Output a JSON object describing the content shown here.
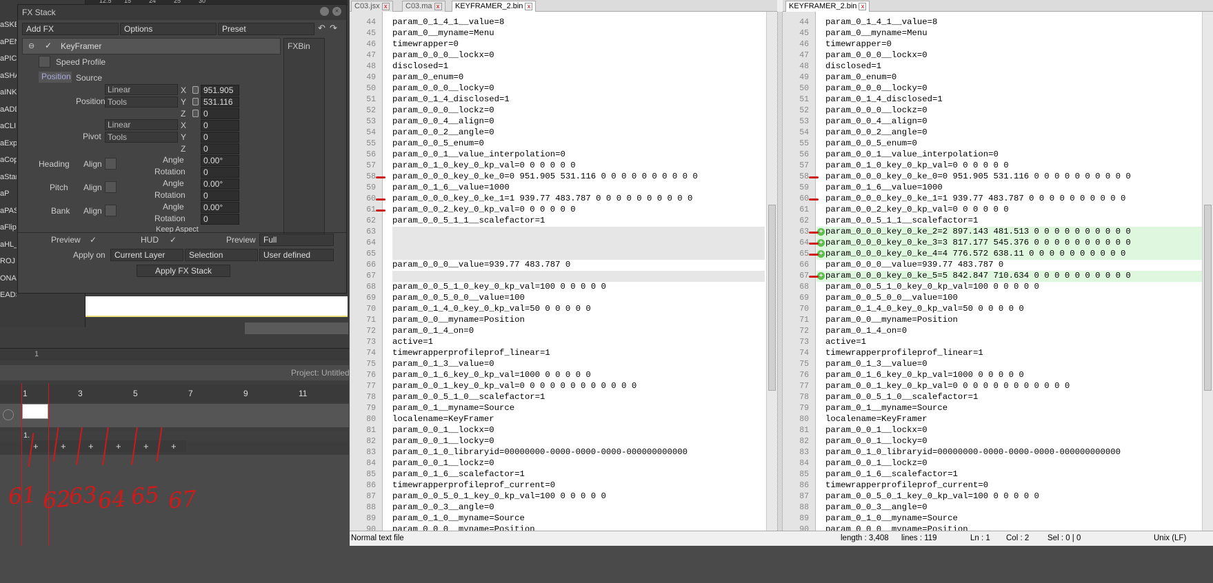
{
  "fx": {
    "title": "FX Stack",
    "add_fx": "Add FX",
    "options": "Options",
    "preset": "Preset",
    "effect_name": "KeyFramer",
    "speed_profile": "Speed Profile",
    "fxbin": "FXBin",
    "tab_position": "Position",
    "tab_source": "Source",
    "position_label": "Position",
    "pivot_label": "Pivot",
    "heading_label": "Heading",
    "pitch_label": "Pitch",
    "bank_label": "Bank",
    "align": "Align",
    "angle": "Angle",
    "rotation": "Rotation",
    "keep_aspect": "Keep Aspect",
    "linear": "Linear",
    "tools": "Tools",
    "x": "X",
    "y": "Y",
    "z": "Z",
    "pos_x": "951.905",
    "pos_y": "531.116",
    "pos_z": "0",
    "piv_x": "0",
    "piv_y": "0",
    "piv_z": "0",
    "heading_angle": "0.00°",
    "heading_rot": "0",
    "pitch_angle": "0.00°",
    "pitch_rot": "0",
    "bank_angle": "0.00°",
    "bank_rot": "0",
    "preview": "Preview",
    "hud": "HUD",
    "preview2": "Preview",
    "full": "Full",
    "apply_on": "Apply on",
    "current_layer": "Current Layer",
    "selection": "Selection",
    "user_defined": "User defined",
    "apply_btn": "Apply FX Stack"
  },
  "sidebar": [
    "aSKE",
    "aPEN",
    "aPICI",
    "aSHA",
    "aINK",
    "aADD",
    "aCLIF",
    "aExp",
    "aCop",
    "aStar",
    "aP",
    "aPAST",
    "aFlip",
    "aHL_S",
    "ROJ",
    "ONA",
    "EADS"
  ],
  "timeline": {
    "top_ruler": [
      "12.5",
      "15",
      "24",
      "25",
      "30"
    ],
    "tl_num": "1",
    "project": "Project: Untitled",
    "frames": [
      "1",
      "3",
      "5",
      "7",
      "9",
      "11"
    ],
    "row_num": "1.",
    "plus": "+"
  },
  "annotations": [
    "61",
    "62",
    "63",
    "64",
    "65",
    "67"
  ],
  "tabs": {
    "t1": "C03.jsx",
    "t2": "C03.ma",
    "t3": "KEYFRAMER_2.bin",
    "t4": "KEYFRAMER_2.bin"
  },
  "left_lines": [
    [
      "44",
      "param_0_1_4_1__value=8"
    ],
    [
      "45",
      "param_0__myname=Menu"
    ],
    [
      "46",
      "timewrapper=0"
    ],
    [
      "47",
      "param_0_0_0__lockx=0"
    ],
    [
      "48",
      "disclosed=1"
    ],
    [
      "49",
      "param_0_enum=0"
    ],
    [
      "50",
      "param_0_0_0__locky=0"
    ],
    [
      "51",
      "param_0_1_4_disclosed=1"
    ],
    [
      "52",
      "param_0_0_0__lockz=0"
    ],
    [
      "53",
      "param_0_0_4__align=0"
    ],
    [
      "54",
      "param_0_0_2__angle=0"
    ],
    [
      "55",
      "param_0_0_5_enum=0"
    ],
    [
      "56",
      "param_0_0_1__value_interpolation=0"
    ],
    [
      "57",
      "param_0_1_0_key_0_kp_val=0 0 0 0 0 0"
    ],
    [
      "58",
      "param_0_0_0_key_0_ke_0=0 951.905 531.116 0 0 0 0 0 0 0 0 0 0"
    ],
    [
      "59",
      "param_0_1_6__value=1000"
    ],
    [
      "60",
      "param_0_0_0_key_0_ke_1=1 939.77 483.787 0 0 0 0 0 0 0 0 0 0"
    ],
    [
      "61",
      "param_0_0_2_key_0_kp_val=0 0 0 0 0 0"
    ],
    [
      "62",
      "param_0_0_5_1_1__scalefactor=1"
    ],
    [
      "63",
      ""
    ],
    [
      "64",
      ""
    ],
    [
      "65",
      ""
    ],
    [
      "66",
      "param_0_0_0__value=939.77 483.787 0"
    ],
    [
      "67",
      ""
    ],
    [
      "68",
      "param_0_0_5_1_0_key_0_kp_val=100 0 0 0 0 0"
    ],
    [
      "69",
      "param_0_0_5_0_0__value=100"
    ],
    [
      "70",
      "param_0_1_4_0_key_0_kp_val=50 0 0 0 0 0"
    ],
    [
      "71",
      "param_0_0__myname=Position"
    ],
    [
      "72",
      "param_0_1_4_on=0"
    ],
    [
      "73",
      "active=1"
    ],
    [
      "74",
      "timewrapperprofileprof_linear=1"
    ],
    [
      "75",
      "param_0_1_3__value=0"
    ],
    [
      "76",
      "param_0_1_6_key_0_kp_val=1000 0 0 0 0 0"
    ],
    [
      "77",
      "param_0_0_1_key_0_kp_val=0 0 0 0 0 0 0 0 0 0 0 0"
    ],
    [
      "78",
      "param_0_0_5_1_0__scalefactor=1"
    ],
    [
      "79",
      "param_0_1__myname=Source"
    ],
    [
      "80",
      "localename=KeyFramer"
    ],
    [
      "81",
      "param_0_0_1__lockx=0"
    ],
    [
      "82",
      "param_0_0_1__locky=0"
    ],
    [
      "83",
      "param_0_1_0_libraryid=00000000-0000-0000-0000-000000000000"
    ],
    [
      "84",
      "param_0_0_1__lockz=0"
    ],
    [
      "85",
      "param_0_1_6__scalefactor=1"
    ],
    [
      "86",
      "timewrapperprofileprof_current=0"
    ],
    [
      "87",
      "param_0_0_5_0_1_key_0_kp_val=100 0 0 0 0 0"
    ],
    [
      "88",
      "param_0_0_3__angle=0"
    ],
    [
      "89",
      "param_0_1_0__myname=Source"
    ],
    [
      "90",
      "param_0_0_0__myname=Position"
    ]
  ],
  "right_lines": [
    [
      "44",
      "param_0_1_4_1__value=8"
    ],
    [
      "45",
      "param_0__myname=Menu"
    ],
    [
      "46",
      "timewrapper=0"
    ],
    [
      "47",
      "param_0_0_0__lockx=0"
    ],
    [
      "48",
      "disclosed=1"
    ],
    [
      "49",
      "param_0_enum=0"
    ],
    [
      "50",
      "param_0_0_0__locky=0"
    ],
    [
      "51",
      "param_0_1_4_disclosed=1"
    ],
    [
      "52",
      "param_0_0_0__lockz=0"
    ],
    [
      "53",
      "param_0_0_4__align=0"
    ],
    [
      "54",
      "param_0_0_2__angle=0"
    ],
    [
      "55",
      "param_0_0_5_enum=0"
    ],
    [
      "56",
      "param_0_0_1__value_interpolation=0"
    ],
    [
      "57",
      "param_0_1_0_key_0_kp_val=0 0 0 0 0 0"
    ],
    [
      "58",
      "param_0_0_0_key_0_ke_0=0 951.905 531.116 0 0 0 0 0 0 0 0 0 0"
    ],
    [
      "59",
      "param_0_1_6__value=1000"
    ],
    [
      "60",
      "param_0_0_0_key_0_ke_1=1 939.77 483.787 0 0 0 0 0 0 0 0 0 0"
    ],
    [
      "61",
      "param_0_0_2_key_0_kp_val=0 0 0 0 0 0"
    ],
    [
      "62",
      "param_0_0_5_1_1__scalefactor=1"
    ],
    [
      "63",
      "param_0_0_0_key_0_ke_2=2 897.143 481.513 0 0 0 0 0 0 0 0 0 0"
    ],
    [
      "64",
      "param_0_0_0_key_0_ke_3=3 817.177 545.376 0 0 0 0 0 0 0 0 0 0"
    ],
    [
      "65",
      "param_0_0_0_key_0_ke_4=4 776.572 638.11 0 0 0 0 0 0 0 0 0 0"
    ],
    [
      "66",
      "param_0_0_0__value=939.77 483.787 0"
    ],
    [
      "67",
      "param_0_0_0_key_0_ke_5=5 842.847 710.634 0 0 0 0 0 0 0 0 0 0"
    ],
    [
      "68",
      "param_0_0_5_1_0_key_0_kp_val=100 0 0 0 0 0"
    ],
    [
      "69",
      "param_0_0_5_0_0__value=100"
    ],
    [
      "70",
      "param_0_1_4_0_key_0_kp_val=50 0 0 0 0 0"
    ],
    [
      "71",
      "param_0_0__myname=Position"
    ],
    [
      "72",
      "param_0_1_4_on=0"
    ],
    [
      "73",
      "active=1"
    ],
    [
      "74",
      "timewrapperprofileprof_linear=1"
    ],
    [
      "75",
      "param_0_1_3__value=0"
    ],
    [
      "76",
      "param_0_1_6_key_0_kp_val=1000 0 0 0 0 0"
    ],
    [
      "77",
      "param_0_0_1_key_0_kp_val=0 0 0 0 0 0 0 0 0 0 0 0"
    ],
    [
      "78",
      "param_0_0_5_1_0__scalefactor=1"
    ],
    [
      "79",
      "param_0_1__myname=Source"
    ],
    [
      "80",
      "localename=KeyFramer"
    ],
    [
      "81",
      "param_0_0_1__lockx=0"
    ],
    [
      "82",
      "param_0_0_1__locky=0"
    ],
    [
      "83",
      "param_0_1_0_libraryid=00000000-0000-0000-0000-000000000000"
    ],
    [
      "84",
      "param_0_0_1__lockz=0"
    ],
    [
      "85",
      "param_0_1_6__scalefactor=1"
    ],
    [
      "86",
      "timewrapperprofileprof_current=0"
    ],
    [
      "87",
      "param_0_0_5_0_1_key_0_kp_val=100 0 0 0 0 0"
    ],
    [
      "88",
      "param_0_0_3__angle=0"
    ],
    [
      "89",
      "param_0_1_0__myname=Source"
    ],
    [
      "90",
      "param_0_0_0__myname=Position"
    ]
  ],
  "status": {
    "filetype": "Normal text file",
    "length": "length : 3,408",
    "lines": "lines : 119",
    "ln": "Ln : 1",
    "col": "Col : 2",
    "sel": "Sel : 0 | 0",
    "eol": "Unix (LF)"
  }
}
